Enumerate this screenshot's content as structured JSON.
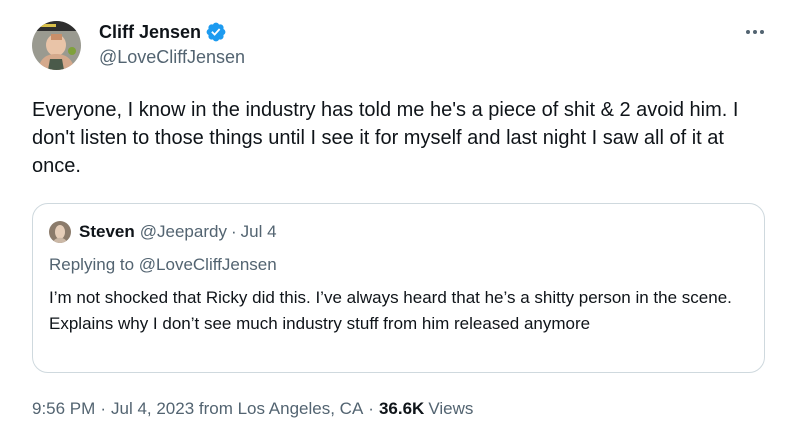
{
  "tweet": {
    "author": {
      "display_name": "Cliff Jensen",
      "handle": "@LoveCliffJensen",
      "verified": true,
      "avatar_icon": "profile-photo"
    },
    "more_icon": "more-options-icon",
    "text": "Everyone, I know in the industry has told me he's a piece of shit & 2 avoid him. I don't listen to those things until I see it for myself and last night I saw all of it at once.",
    "quoted": {
      "author_name": "Steven",
      "author_handle": "@Jeepardy",
      "separator": "·",
      "date": "Jul 4",
      "replying_to": "Replying to @LoveCliffJensen",
      "text": "I’m not shocked that Ricky did this. I’ve always heard that he’s a shitty person in the scene. Explains why I don’t see much industry stuff from him released anymore"
    },
    "footer": {
      "time": "9:56 PM",
      "separator": "·",
      "date": "Jul 4, 2023 from Los Angeles, CA",
      "views_count": "36.6K",
      "views_label": "Views"
    }
  },
  "colors": {
    "text": "#0f1419",
    "secondary": "#536471",
    "verified_badge": "#1d9bf0",
    "border": "#cfd9de"
  }
}
